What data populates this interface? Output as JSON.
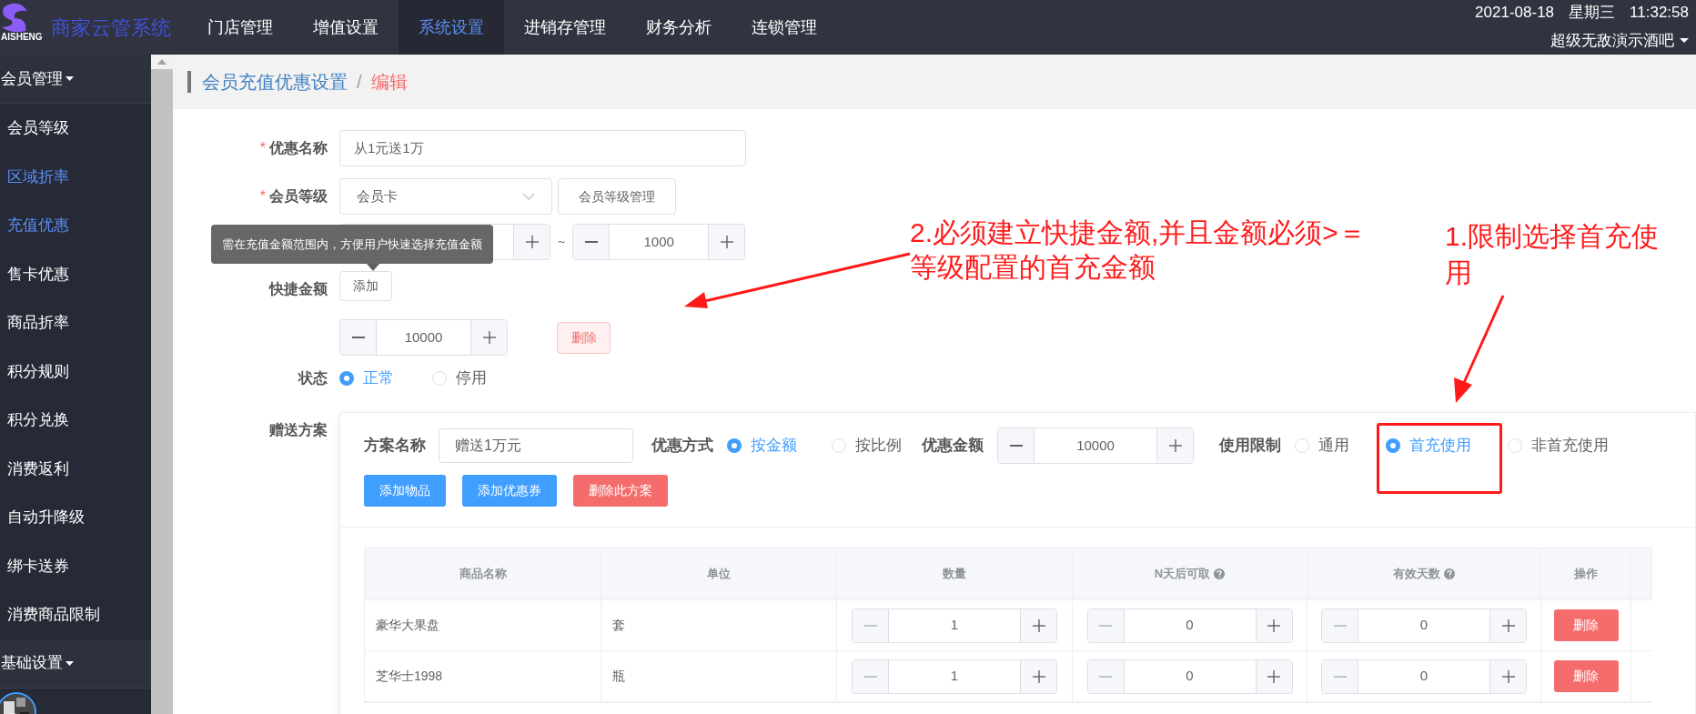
{
  "header": {
    "logo_text": "AISHENG",
    "app_title": "商家云管系统",
    "nav": [
      {
        "label": "门店管理",
        "selected": false
      },
      {
        "label": "增值设置",
        "selected": false
      },
      {
        "label": "系统设置",
        "selected": true
      },
      {
        "label": "进销存管理",
        "selected": false
      },
      {
        "label": "财务分析",
        "selected": false
      },
      {
        "label": "连锁管理",
        "selected": false
      }
    ],
    "date": "2021-08-18",
    "weekday": "星期三",
    "time": "11:32:58",
    "store_name": "超级无敌演示酒吧"
  },
  "sidebar": {
    "groups": [
      {
        "label": "会员管理",
        "items": [
          {
            "label": "会员等级",
            "selected": false
          },
          {
            "label": "区域折率",
            "selected": true
          },
          {
            "label": "充值优惠",
            "selected": true
          },
          {
            "label": "售卡优惠",
            "selected": false
          },
          {
            "label": "商品折率",
            "selected": false
          },
          {
            "label": "积分规则",
            "selected": false
          },
          {
            "label": "积分兑换",
            "selected": false
          },
          {
            "label": "消费返利",
            "selected": false
          },
          {
            "label": "自动升降级",
            "selected": false
          },
          {
            "label": "绑卡送券",
            "selected": false
          },
          {
            "label": "消费商品限制",
            "selected": false
          }
        ]
      },
      {
        "label": "基础设置"
      }
    ]
  },
  "breadcrumb": [
    {
      "label": "会员充值优惠设置",
      "current": false
    },
    {
      "label": "编辑",
      "current": true
    }
  ],
  "breadcrumb_separator": "/",
  "form": {
    "name": {
      "label": "优惠名称",
      "required_mark": "*",
      "value": "从1元送1万"
    },
    "level": {
      "label": "会员等级",
      "required_mark": "*",
      "value": "会员卡",
      "manage_button": "会员等级管理"
    },
    "range": {
      "separator": "~",
      "max": "1000"
    },
    "tooltip": "需在充值金额范围内，方便用户快速选择充值金额",
    "quick": {
      "label": "快捷金额",
      "add_button": "添加",
      "amounts": [
        {
          "value": "10000",
          "delete_button": "删除"
        }
      ]
    },
    "status": {
      "label": "状态",
      "options": [
        {
          "label": "正常",
          "selected": true
        },
        {
          "label": "停用",
          "selected": false
        }
      ]
    },
    "gift": {
      "label": "赠送方案",
      "plan_name": {
        "label": "方案名称",
        "value": "赠送1万元"
      },
      "mode": {
        "label": "优惠方式",
        "options": [
          {
            "label": "按金额",
            "selected": true
          },
          {
            "label": "按比例",
            "selected": false
          }
        ]
      },
      "amount": {
        "label": "优惠金额",
        "value": "10000"
      },
      "limit": {
        "label": "使用限制",
        "options": [
          {
            "label": "通用",
            "selected": false
          },
          {
            "label": "首充使用",
            "selected": true
          },
          {
            "label": "非首充使用",
            "selected": false
          }
        ]
      },
      "buttons": [
        {
          "label": "添加物品",
          "kind": "primary"
        },
        {
          "label": "添加优惠券",
          "kind": "primary"
        },
        {
          "label": "删除此方案",
          "kind": "danger"
        }
      ],
      "table": {
        "columns": [
          {
            "label": "商品名称",
            "help": false
          },
          {
            "label": "单位",
            "help": false
          },
          {
            "label": "数量",
            "help": false
          },
          {
            "label": "N天后可取",
            "help": true
          },
          {
            "label": "有效天数",
            "help": true
          },
          {
            "label": "操作",
            "help": false
          }
        ],
        "rows": [
          {
            "name": "豪华大果盘",
            "unit": "套",
            "quantity": "1",
            "days_after": "0",
            "valid_days": "0",
            "delete_button": "删除"
          },
          {
            "name": "芝华士1998",
            "unit": "瓶",
            "quantity": "1",
            "days_after": "0",
            "valid_days": "0",
            "delete_button": "删除"
          }
        ]
      }
    }
  },
  "annotations": [
    {
      "lines": [
        "2.必须建立快捷金额,并且金额必须>＝",
        "等级配置的首充金额"
      ]
    },
    {
      "lines": [
        "1.限制选择首充使",
        "用"
      ]
    }
  ]
}
